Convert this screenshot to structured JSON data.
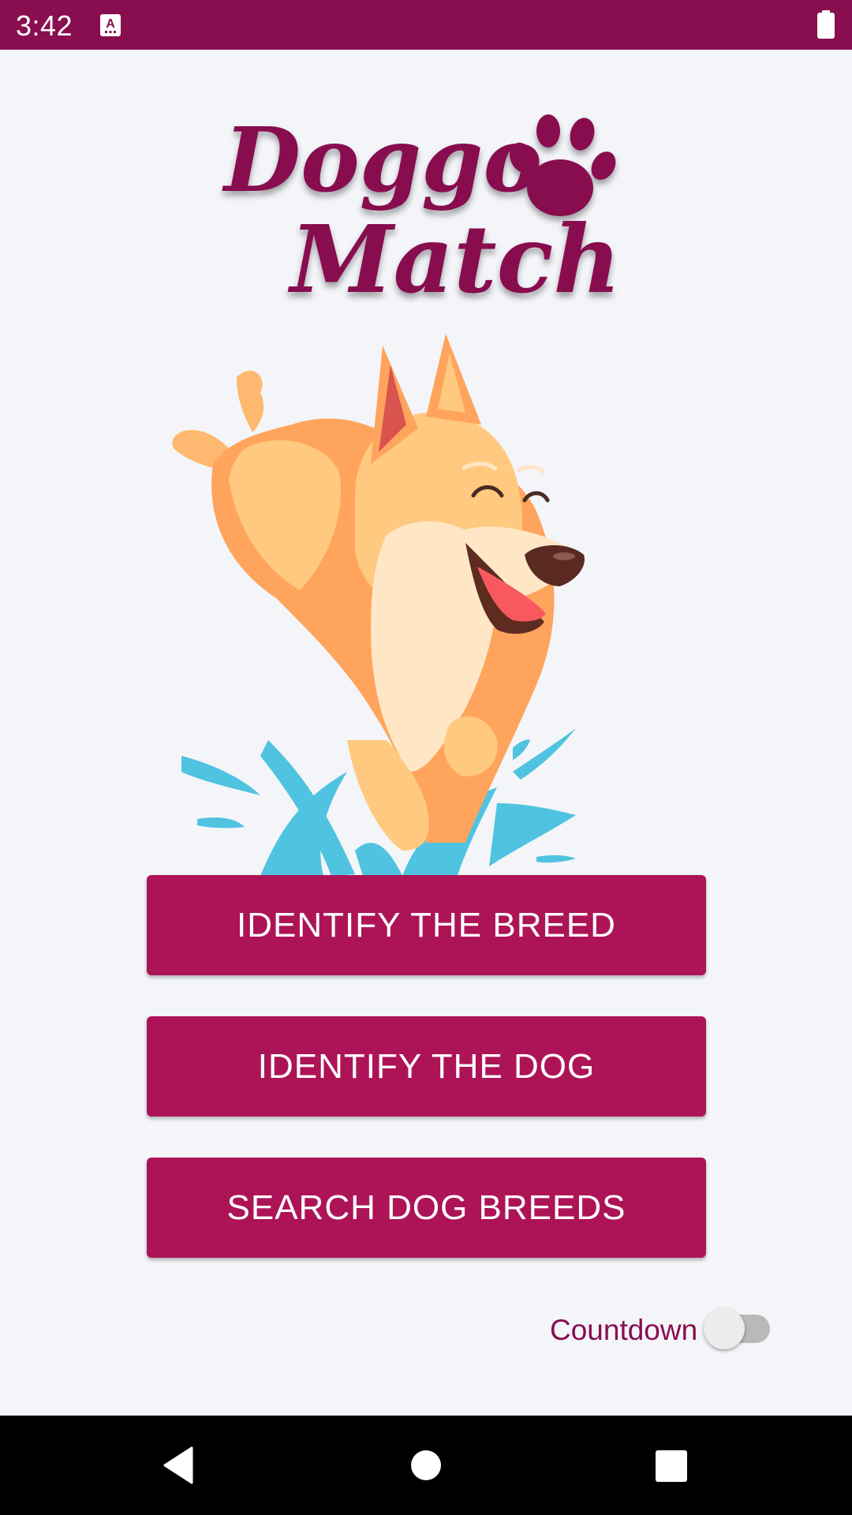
{
  "status_bar": {
    "time": "3:42",
    "notification_icon": "keyboard-a-icon",
    "battery_icon": "battery-full-icon",
    "background_color": "#880e4f"
  },
  "logo": {
    "line1": "Doggo",
    "line2": "Match",
    "icon": "paw-print-icon",
    "color": "#880e4f"
  },
  "illustration": {
    "description_icon": "jumping-dog-splash-illustration"
  },
  "buttons": {
    "identify_breed": "IDENTIFY THE BREED",
    "identify_dog": "IDENTIFY THE DOG",
    "search_breeds": "SEARCH DOG BREEDS",
    "color": "#ad1457"
  },
  "countdown": {
    "label": "Countdown",
    "enabled": false
  },
  "nav_bar": {
    "back_icon": "back-triangle-icon",
    "home_icon": "home-circle-icon",
    "recents_icon": "recents-square-icon"
  }
}
